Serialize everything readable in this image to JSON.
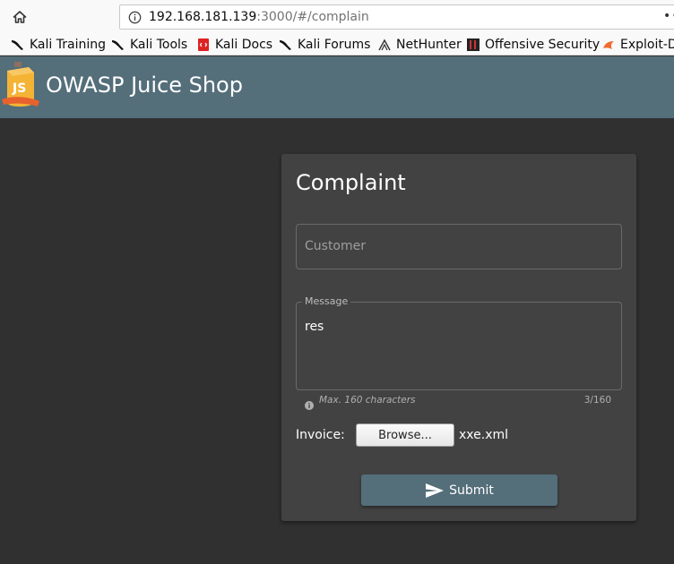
{
  "browser": {
    "url_host": "192.168.181.139",
    "url_rest": ":3000/#/complain",
    "bookmarks": [
      {
        "label": "Kali Training",
        "icon": "kali-dragon-icon"
      },
      {
        "label": "Kali Tools",
        "icon": "kali-dragon-icon"
      },
      {
        "label": "Kali Docs",
        "icon": "kali-docs-icon"
      },
      {
        "label": "Kali Forums",
        "icon": "kali-dragon-icon"
      },
      {
        "label": "NetHunter",
        "icon": "nethunter-icon"
      },
      {
        "label": "Offensive Security",
        "icon": "offsec-icon"
      },
      {
        "label": "Exploit-D",
        "icon": "exploit-db-icon"
      }
    ]
  },
  "app": {
    "title": "OWASP Juice Shop",
    "toolbar_color": "#546e7a"
  },
  "complaint": {
    "title": "Complaint",
    "customer_placeholder": "Customer",
    "message_label": "Message",
    "message_value": "res",
    "hint": "Max. 160 characters",
    "char_count": "3/160",
    "invoice_label": "Invoice:",
    "browse_label": "Browse...",
    "file_name": "xxe.xml",
    "submit_label": "Submit"
  }
}
